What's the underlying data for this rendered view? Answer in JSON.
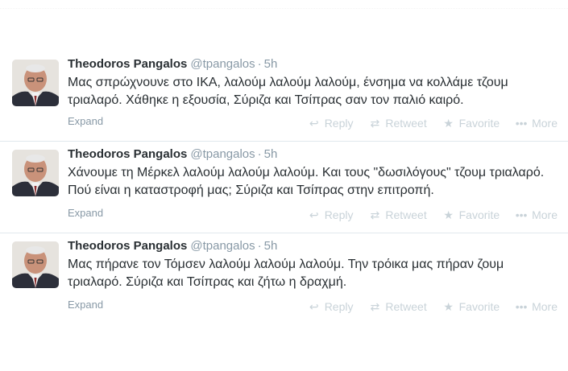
{
  "tweets": [
    {
      "fullname": "Theodoros Pangalos",
      "username": "@tpangalos",
      "dot": "·",
      "time": "5h",
      "text": "Μας σπρώχνουνε στο ΙΚΑ, λαλούμ λαλούμ λαλούμ, ένσημα να κολλάμε τζουμ τριαλαρό. Χάθηκε η εξουσία, Σύριζα και Τσίπρας σαν τον παλιό καιρό.",
      "expand": "Expand"
    },
    {
      "fullname": "Theodoros Pangalos",
      "username": "@tpangalos",
      "dot": "·",
      "time": "5h",
      "text": "Χάνουμε τη Μέρκελ λαλούμ λαλούμ λαλούμ. Και τους \"δωσιλόγους\" τζουμ τριαλαρό. Πού είναι η καταστροφή μας; Σύριζα και Τσίπρας στην επιτροπή.",
      "expand": "Expand"
    },
    {
      "fullname": "Theodoros Pangalos",
      "username": "@tpangalos",
      "dot": "·",
      "time": "5h",
      "text": "Μας πήρανε τον Τόμσεν λαλούμ λαλούμ λαλούμ. Την τρόικα μας πήραν ζουμ τριαλαρό. Σύριζα και Τσίπρας και ζήτω η δραχμή.",
      "expand": "Expand"
    }
  ],
  "actions": {
    "reply": "Reply",
    "retweet": "Retweet",
    "favorite": "Favorite",
    "more": "More"
  },
  "icons": {
    "reply": "reply-arrow-icon",
    "retweet": "retweet-icon",
    "favorite": "star-icon",
    "more": "ellipsis-icon"
  },
  "colors": {
    "name": "#292f33",
    "meta": "#8899a6",
    "action": "#c9d3d9",
    "divider": "#e1e8ed"
  }
}
